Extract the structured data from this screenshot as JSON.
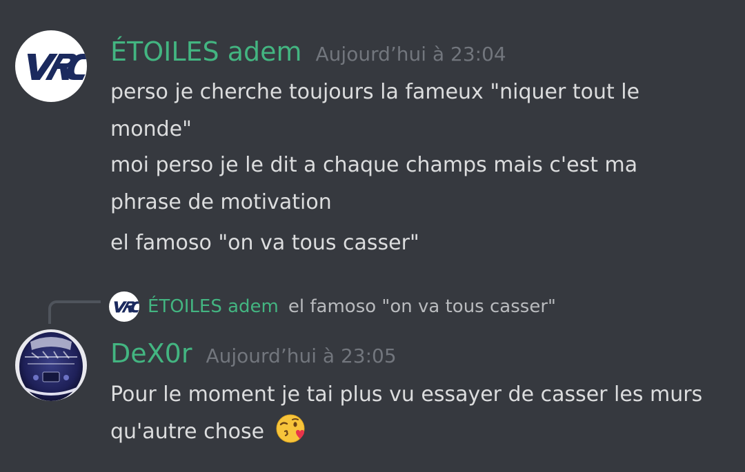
{
  "messages": [
    {
      "author": "ÉTOILES adem",
      "timestamp": "Aujourd’hui à 23:04",
      "avatar_icon": "vrc-logo",
      "lines": [
        "perso je cherche toujours la fameux \"niquer tout le",
        "monde\"",
        "moi perso je le dit a chaque champs mais c'est ma",
        "phrase de motivation",
        "el famoso \"on va tous casser\""
      ]
    },
    {
      "reply_to": {
        "author": "ÉTOILES adem",
        "text": "el famoso \"on va tous casser\""
      },
      "author": "DeX0r",
      "timestamp": "Aujourd’hui à 23:05",
      "avatar_icon": "helmet-avatar",
      "lines": [
        "Pour le moment je tai plus vu essayer de casser les murs",
        "qu'autre chose"
      ],
      "emoji": "face-blowing-kiss"
    }
  ],
  "colors": {
    "background": "#36393f",
    "username": "#43b581",
    "timestamp": "#72767d",
    "message_text": "#dcddde",
    "reply_text": "#b9bbbe",
    "vrc_logo": "#1b2a5e"
  }
}
